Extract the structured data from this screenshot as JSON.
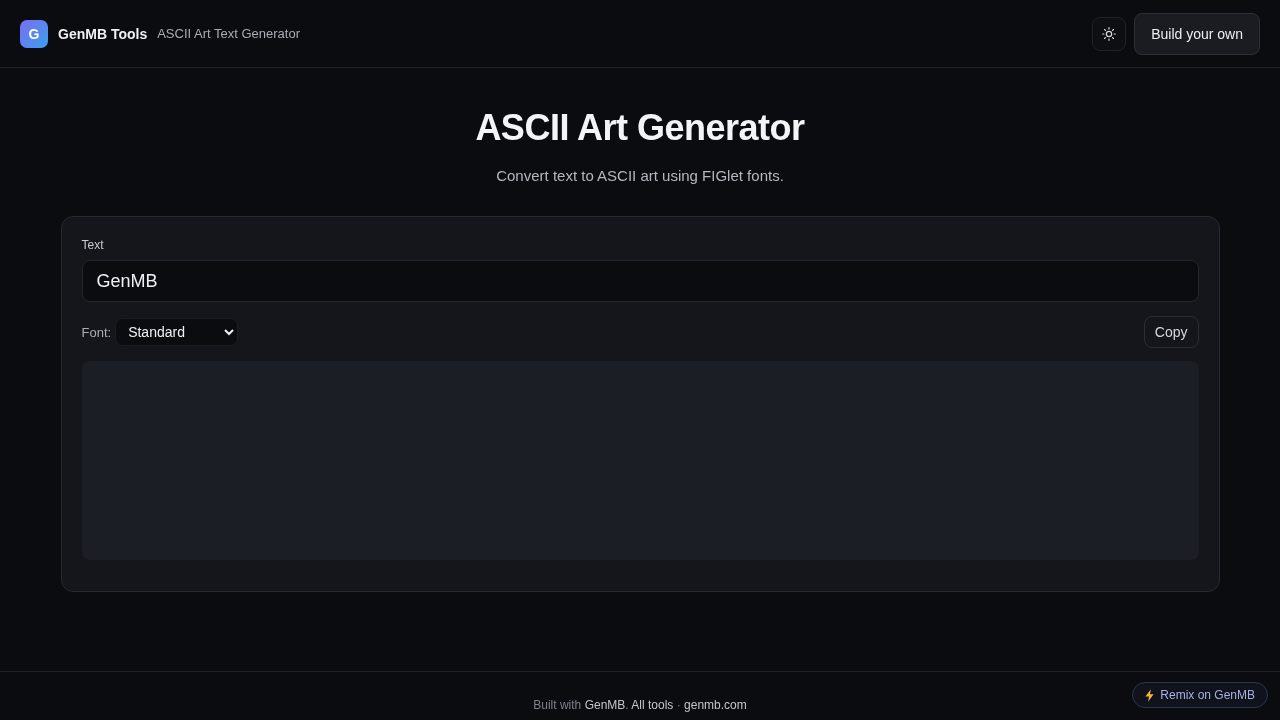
{
  "header": {
    "logo_letter": "G",
    "brand": "GenMB Tools",
    "tool_name": "ASCII Art Text Generator",
    "build_button": "Build your own"
  },
  "hero": {
    "title": "ASCII Art Generator",
    "subtitle": "Convert text to ASCII art using FIGlet fonts."
  },
  "form": {
    "text_label": "Text",
    "text_value": "GenMB",
    "font_label": "Font:",
    "font_value": "Standard",
    "copy_button": "Copy"
  },
  "footer": {
    "parts": [
      {
        "kind": "text",
        "text": "Built with "
      },
      {
        "kind": "link",
        "text": "GenMB"
      },
      {
        "kind": "text",
        "text": ". "
      },
      {
        "kind": "link",
        "text": "All tools"
      },
      {
        "kind": "text",
        "text": " · "
      },
      {
        "kind": "link",
        "text": "genmb.com"
      }
    ],
    "remix_badge": "Remix on GenMB"
  }
}
